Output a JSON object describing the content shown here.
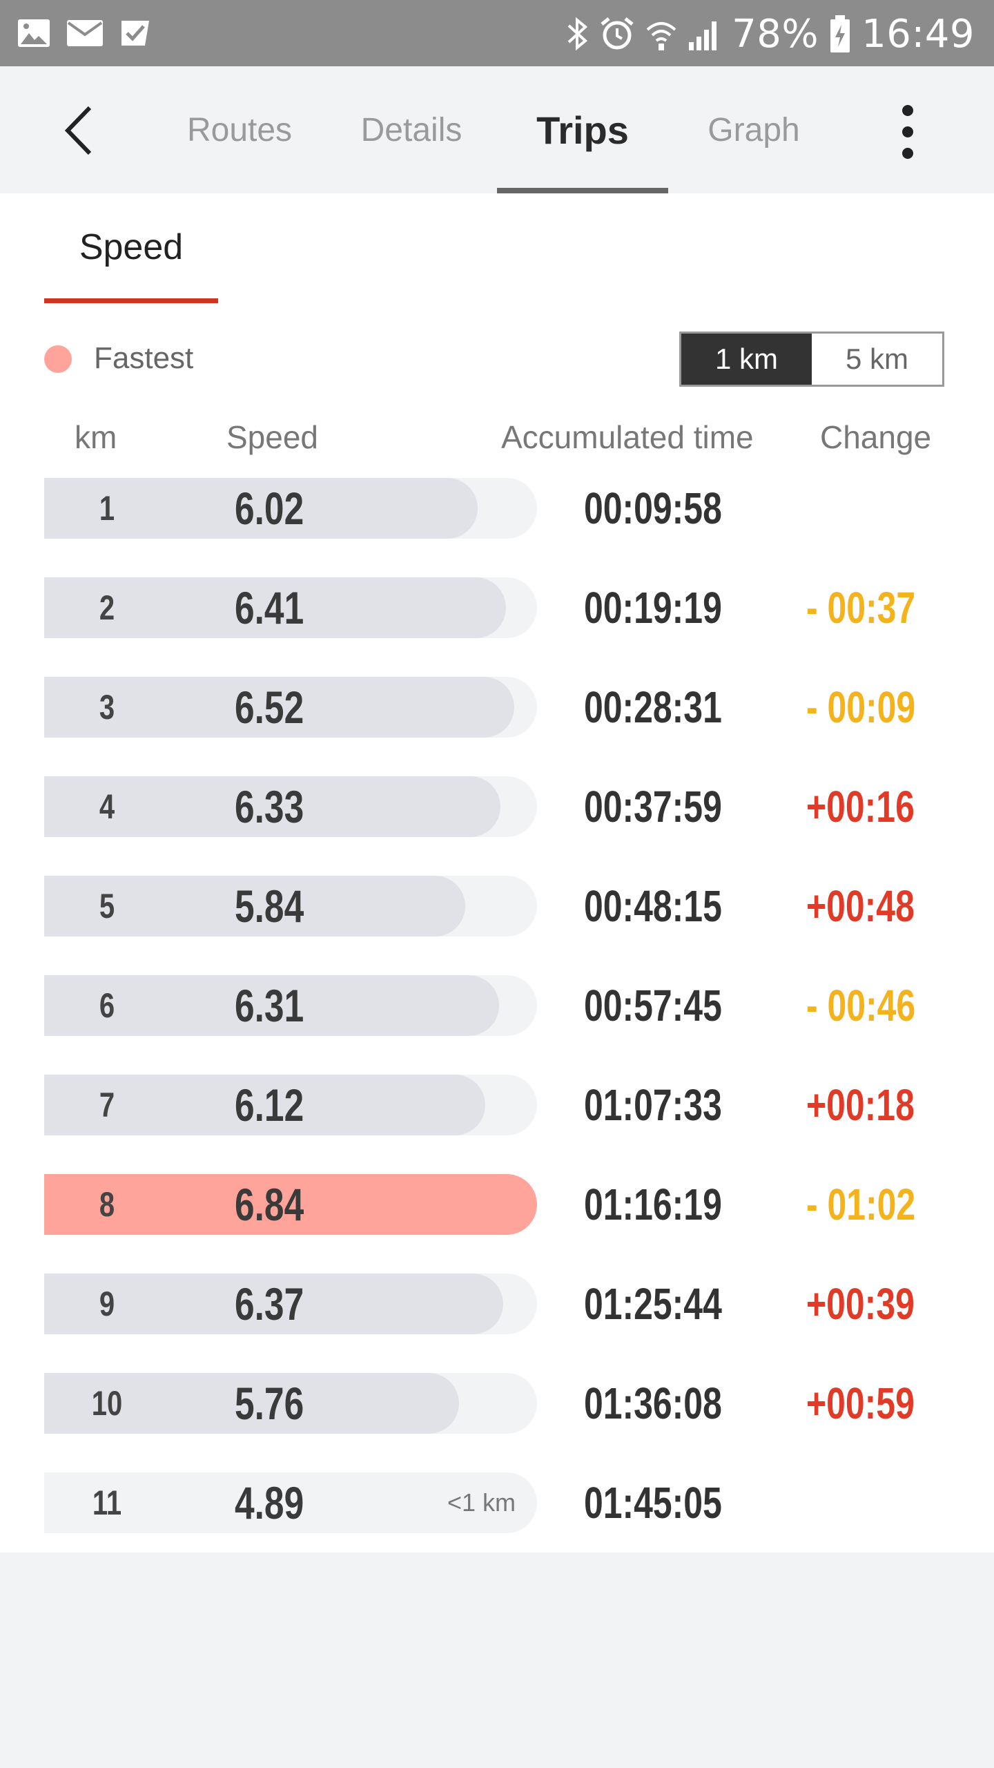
{
  "status_bar": {
    "battery": "78%",
    "time": "16:49",
    "icons": [
      "image-icon",
      "mail-icon",
      "task-icon",
      "bluetooth-icon",
      "alarm-icon",
      "wifi-icon",
      "signal-icon",
      "battery-charging-icon"
    ]
  },
  "app_bar": {
    "back_icon": "back-arrow-icon",
    "tabs": [
      {
        "label": "Routes",
        "active": false
      },
      {
        "label": "Details",
        "active": false
      },
      {
        "label": "Trips",
        "active": true
      },
      {
        "label": "Graph",
        "active": false
      }
    ],
    "more_icon": "more-vert-icon"
  },
  "subtab": {
    "label": "Speed"
  },
  "legend": {
    "label": "Fastest",
    "color": "#ffa49a"
  },
  "unit_toggle": {
    "options": [
      "1 km",
      "5 km"
    ],
    "selected": "1 km"
  },
  "columns": {
    "km": "km",
    "speed": "Speed",
    "accumulated": "Accumulated time",
    "change": "Change"
  },
  "rows": [
    {
      "km": "1",
      "speed": "6.02",
      "speed_value": 6.02,
      "accumulated": "00:09:58",
      "change": "",
      "trend": "none"
    },
    {
      "km": "2",
      "speed": "6.41",
      "speed_value": 6.41,
      "accumulated": "00:19:19",
      "change": "- 00:37",
      "trend": "faster"
    },
    {
      "km": "3",
      "speed": "6.52",
      "speed_value": 6.52,
      "accumulated": "00:28:31",
      "change": "- 00:09",
      "trend": "faster"
    },
    {
      "km": "4",
      "speed": "6.33",
      "speed_value": 6.33,
      "accumulated": "00:37:59",
      "change": "+00:16",
      "trend": "slower"
    },
    {
      "km": "5",
      "speed": "5.84",
      "speed_value": 5.84,
      "accumulated": "00:48:15",
      "change": "+00:48",
      "trend": "slower"
    },
    {
      "km": "6",
      "speed": "6.31",
      "speed_value": 6.31,
      "accumulated": "00:57:45",
      "change": "- 00:46",
      "trend": "faster"
    },
    {
      "km": "7",
      "speed": "6.12",
      "speed_value": 6.12,
      "accumulated": "01:07:33",
      "change": "+00:18",
      "trend": "slower"
    },
    {
      "km": "8",
      "speed": "6.84",
      "speed_value": 6.84,
      "accumulated": "01:16:19",
      "change": "- 01:02",
      "trend": "faster",
      "fastest": true
    },
    {
      "km": "9",
      "speed": "6.37",
      "speed_value": 6.37,
      "accumulated": "01:25:44",
      "change": "+00:39",
      "trend": "slower"
    },
    {
      "km": "10",
      "speed": "5.76",
      "speed_value": 5.76,
      "accumulated": "01:36:08",
      "change": "+00:59",
      "trend": "slower"
    },
    {
      "km": "11",
      "speed": "4.89",
      "speed_value": 4.89,
      "accumulated": "01:45:05",
      "change": "",
      "trend": "none",
      "partial_label": "<1 km"
    }
  ]
}
